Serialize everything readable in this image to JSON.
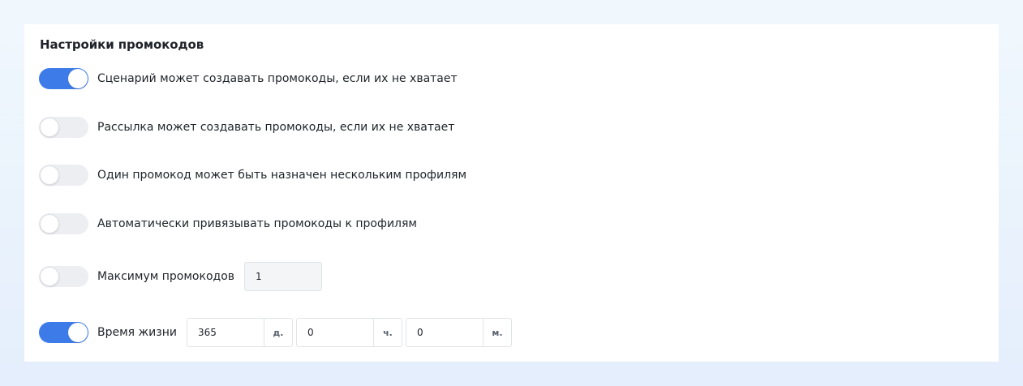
{
  "section": {
    "title": "Настройки промокодов"
  },
  "settings": [
    {
      "label": "Сценарий может создавать промокоды, если их не хватает",
      "enabled": true
    },
    {
      "label": "Рассылка может создавать промокоды, если их не хватает",
      "enabled": false
    },
    {
      "label": "Один промокод может быть назначен нескольким профилям",
      "enabled": false
    },
    {
      "label": "Автоматически привязывать промокоды к профилям",
      "enabled": false
    },
    {
      "label": "Максимум промокодов",
      "enabled": false,
      "value": "1"
    },
    {
      "label": "Время жизни",
      "enabled": true,
      "days": "365",
      "days_unit": "д.",
      "hours": "0",
      "hours_unit": "ч.",
      "minutes": "0",
      "minutes_unit": "м."
    }
  ],
  "colors": {
    "toggle_on": "#3d7be8",
    "toggle_off": "#edeef2"
  }
}
